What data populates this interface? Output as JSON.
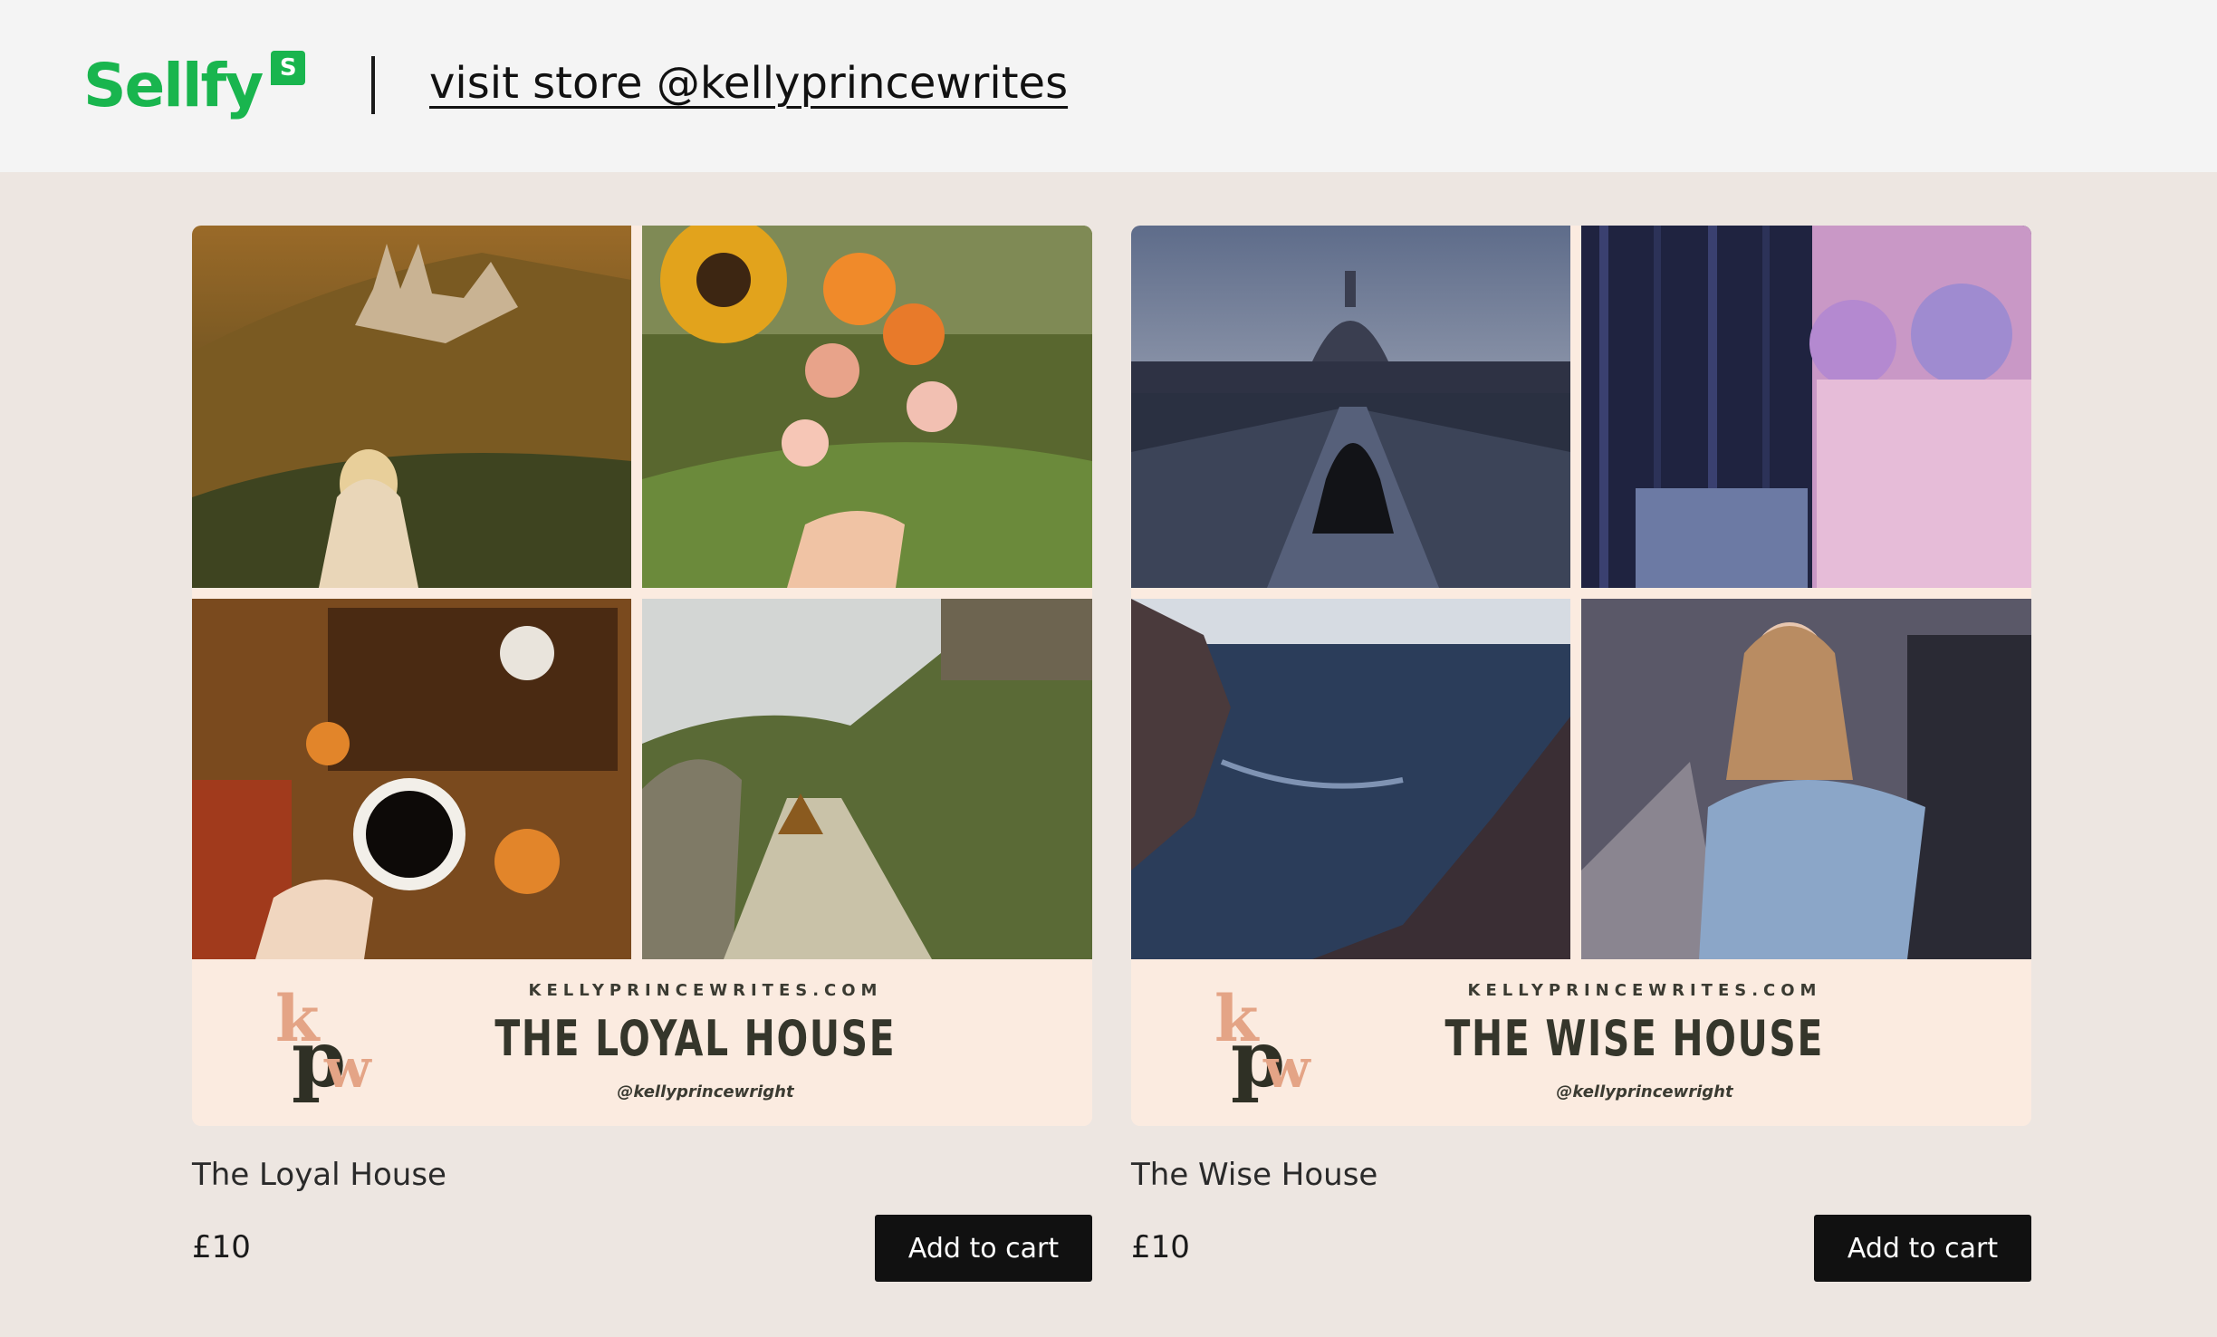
{
  "header": {
    "brand": "Sellfy",
    "badge": "S",
    "visit_link": "visit store @kellyprincewrites"
  },
  "products": [
    {
      "name": "The Loyal House",
      "price": "£10",
      "cta": "Add to cart",
      "cover": {
        "logo": {
          "k": "k",
          "p": "p",
          "w": "w"
        },
        "site": "KELLYPRINCEWRITES.COM",
        "title": "THE LOYAL HOUSE",
        "handle": "@kellyprincewright"
      }
    },
    {
      "name": "The Wise House",
      "price": "£10",
      "cta": "Add to cart",
      "cover": {
        "logo": {
          "k": "k",
          "p": "p",
          "w": "w"
        },
        "site": "KELLYPRINCEWRITES.COM",
        "title": "THE WISE HOUSE",
        "handle": "@kellyprincewright"
      }
    }
  ],
  "colors": {
    "brand_green": "#19b54e",
    "page_bg": "#ede6e1",
    "header_bg": "#f4f4f4",
    "button_bg": "#111111",
    "cover_bg": "#fbebe0",
    "logo_peach": "#e4a486",
    "logo_dark": "#2f3025"
  }
}
